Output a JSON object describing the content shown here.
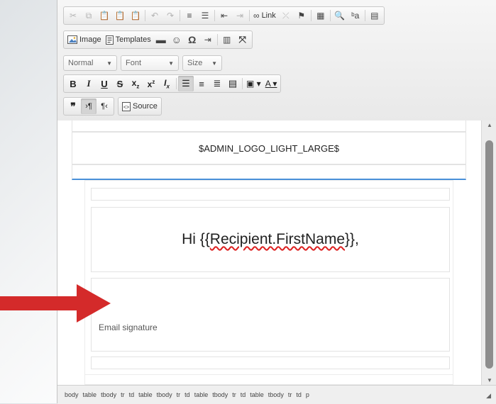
{
  "toolbar": {
    "row1": [
      {
        "name": "cut-button",
        "glyph": "✂",
        "disabled": true
      },
      {
        "name": "copy-button",
        "glyph": "⧉",
        "disabled": true
      },
      {
        "name": "paste-button",
        "glyph": "📋",
        "disabled": false
      },
      {
        "name": "paste-text-button",
        "glyph": "📋",
        "disabled": false
      },
      {
        "name": "paste-word-button",
        "glyph": "📋",
        "disabled": false
      },
      {
        "sep": true
      },
      {
        "name": "undo-button",
        "glyph": "↶",
        "disabled": true
      },
      {
        "name": "redo-button",
        "glyph": "↷",
        "disabled": true
      },
      {
        "sep": true
      },
      {
        "name": "numbered-list-button",
        "glyph": "≡",
        "disabled": false
      },
      {
        "name": "bulleted-list-button",
        "glyph": "☰",
        "disabled": false
      },
      {
        "sep": true
      },
      {
        "name": "decrease-indent-button",
        "glyph": "⇤",
        "disabled": false
      },
      {
        "name": "increase-indent-button",
        "glyph": "⇥",
        "disabled": true
      },
      {
        "sep": true
      },
      {
        "name": "link-button",
        "glyph": "∞",
        "label": "Link",
        "disabled": false
      },
      {
        "name": "unlink-button",
        "glyph": "⤫",
        "disabled": true
      },
      {
        "name": "anchor-button",
        "glyph": "⚑",
        "disabled": false
      },
      {
        "sep": true
      },
      {
        "name": "table-button",
        "glyph": "▦",
        "disabled": false
      },
      {
        "sep": true
      },
      {
        "name": "find-button",
        "glyph": "🔍",
        "disabled": false
      },
      {
        "name": "replace-button",
        "glyph": "ᵇa",
        "disabled": false
      },
      {
        "sep": true
      },
      {
        "name": "select-all-button",
        "glyph": "▤",
        "disabled": false
      }
    ],
    "image_label": "Image",
    "templates_label": "Templates",
    "format_value": "Normal",
    "font_value": "Font",
    "size_value": "Size",
    "source_label": "Source"
  },
  "content": {
    "logo_placeholder": "$ADMIN_LOGO_LIGHT_LARGE$",
    "greeting_prefix": "Hi {{",
    "greeting_var": "Recipient.FirstName",
    "greeting_suffix": "}},",
    "signature": "Email signature"
  },
  "statusbar": {
    "path": [
      "body",
      "table",
      "tbody",
      "tr",
      "td",
      "table",
      "tbody",
      "tr",
      "td",
      "table",
      "tbody",
      "tr",
      "td",
      "table",
      "tbody",
      "tr",
      "td",
      "p"
    ]
  },
  "colors": {
    "accent_line": "#4a90d9",
    "arrow": "#d42a2a"
  }
}
